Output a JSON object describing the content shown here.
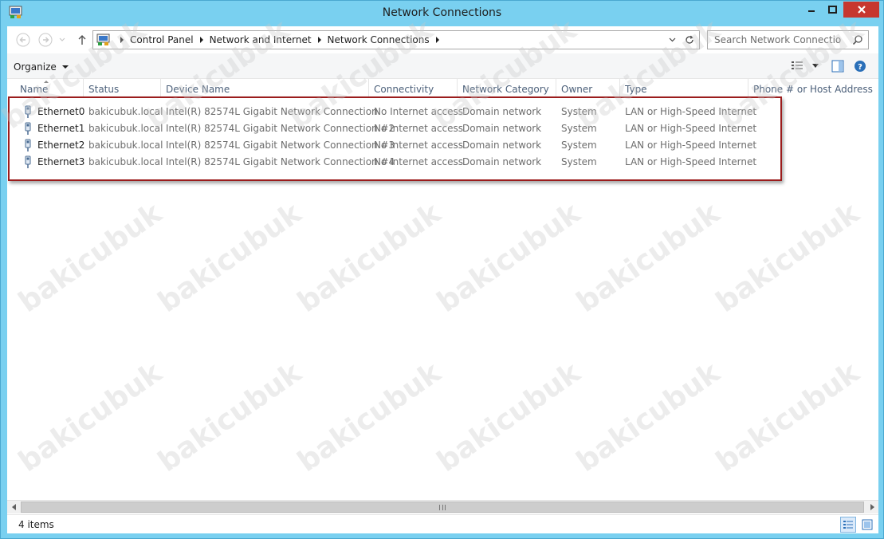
{
  "window": {
    "title": "Network Connections",
    "accent": "#79d0f0",
    "close_color": "#c7372f"
  },
  "address": {
    "crumbs": [
      "Control Panel",
      "Network and Internet",
      "Network Connections"
    ]
  },
  "search": {
    "placeholder": "Search Network Connections"
  },
  "toolbar": {
    "organize_label": "Organize"
  },
  "columns": [
    "Name",
    "Status",
    "Device Name",
    "Connectivity",
    "Network Category",
    "Owner",
    "Type",
    "Phone # or Host Address"
  ],
  "rows": [
    {
      "name": "Ethernet0",
      "status": "bakicubuk.local",
      "device": "Intel(R) 82574L Gigabit Network Connection",
      "connectivity": "No Internet access",
      "category": "Domain network",
      "owner": "System",
      "type": "LAN or High-Speed Internet"
    },
    {
      "name": "Ethernet1",
      "status": "bakicubuk.local",
      "device": "Intel(R) 82574L Gigabit Network Connection #2",
      "connectivity": "No Internet access",
      "category": "Domain network",
      "owner": "System",
      "type": "LAN or High-Speed Internet"
    },
    {
      "name": "Ethernet2",
      "status": "bakicubuk.local",
      "device": "Intel(R) 82574L Gigabit Network Connection #3",
      "connectivity": "No Internet access",
      "category": "Domain network",
      "owner": "System",
      "type": "LAN or High-Speed Internet"
    },
    {
      "name": "Ethernet3",
      "status": "bakicubuk.local",
      "device": "Intel(R) 82574L Gigabit Network Connection #4",
      "connectivity": "No Internet access",
      "category": "Domain network",
      "owner": "System",
      "type": "LAN or High-Speed Internet"
    }
  ],
  "statusbar": {
    "items_text": "4 items"
  },
  "watermark": "bakicubuk",
  "highlight_color": "#9b1c1c"
}
